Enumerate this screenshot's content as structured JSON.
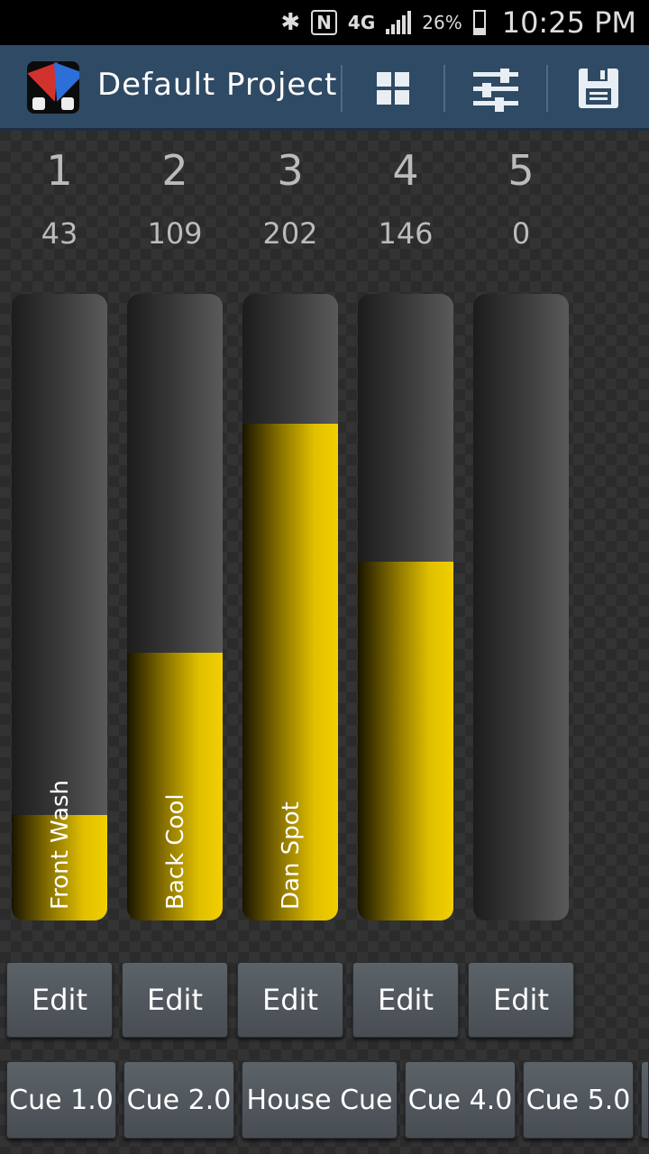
{
  "status_bar": {
    "bluetooth_icon": "bluetooth-icon",
    "nfc_label": "N",
    "network": "4G",
    "battery_percent": "26%",
    "battery_level": 0.26,
    "time": "10:25 PM"
  },
  "toolbar": {
    "title": "Default Project",
    "buttons": [
      "grid-view-icon",
      "sliders-icon",
      "save-icon"
    ]
  },
  "channels": [
    {
      "number": "1",
      "value": "43",
      "level": 43,
      "label": "Front Wash",
      "edit_label": "Edit"
    },
    {
      "number": "2",
      "value": "109",
      "level": 109,
      "label": "Back Cool",
      "edit_label": "Edit"
    },
    {
      "number": "3",
      "value": "202",
      "level": 202,
      "label": "Dan Spot",
      "edit_label": "Edit"
    },
    {
      "number": "4",
      "value": "146",
      "level": 146,
      "label": "",
      "edit_label": "Edit"
    },
    {
      "number": "5",
      "value": "0",
      "level": 0,
      "label": "",
      "edit_label": "Edit"
    }
  ],
  "fader_max": 255,
  "cues": [
    "Cue 1.0",
    "Cue 2.0",
    "House Cue",
    "Cue 4.0",
    "Cue 5.0"
  ],
  "colors": {
    "fill": "#f2cf00",
    "toolbar": "#2f4a64"
  }
}
